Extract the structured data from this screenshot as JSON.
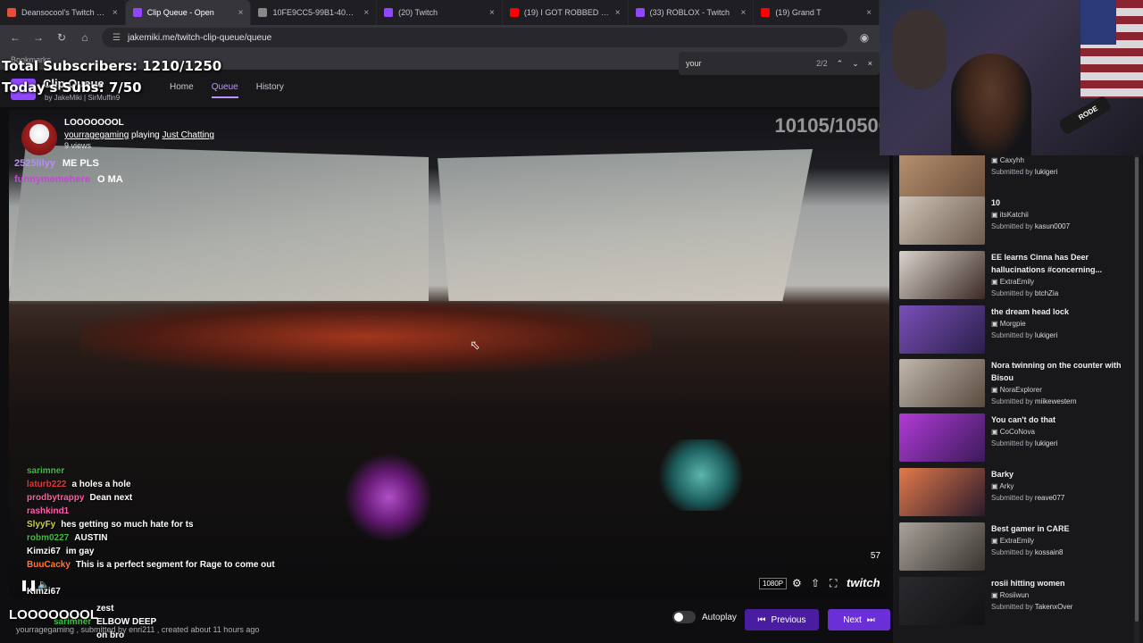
{
  "browser": {
    "tabs": [
      {
        "title": "Deansocool's Twitch Statistic",
        "color": "#e74c3c",
        "active": false
      },
      {
        "title": "Clip Queue - Open",
        "color": "#9147ff",
        "active": true
      },
      {
        "title": "10FE9CC5-99B1-40FD-A523",
        "color": "#888888",
        "active": false
      },
      {
        "title": "(20) Twitch",
        "color": "#9147ff",
        "active": false
      },
      {
        "title": "(19) I GOT ROBBED - The Lon",
        "color": "#ff0000",
        "active": false
      },
      {
        "title": "(33) ROBLOX - Twitch",
        "color": "#9147ff",
        "active": false
      },
      {
        "title": "(19) Grand T",
        "color": "#ff0000",
        "active": false
      }
    ],
    "url": "jakemiki.me/twitch-clip-queue/queue",
    "bookmarks": "Bookmarks",
    "find": {
      "query": "your",
      "count": "2/2"
    }
  },
  "overlay": {
    "total_subs": "Total Subscribers: 1210/1250",
    "today_subs": "Today's Subs: 7/50",
    "viewers": "10105/10500"
  },
  "app": {
    "name": "Clip Queue",
    "by": "by JakeMiki | SirMuffin9",
    "nav": [
      {
        "label": "Home",
        "selected": false
      },
      {
        "label": "Queue",
        "selected": true
      },
      {
        "label": "History",
        "selected": false
      }
    ]
  },
  "clip": {
    "title": "LOOOOOOOL",
    "channel": "yourragegaming",
    "playing": "playing",
    "category": "Just Chatting",
    "views": "9 views"
  },
  "overlay_chat": [
    {
      "name": "2525lilyy",
      "msg": "ME PLS",
      "color": "#b98cf5"
    },
    {
      "name": "funnymemehere",
      "msg": "O MA",
      "color": "#c14ad0"
    }
  ],
  "chat": [
    {
      "name": "sarimner",
      "msg": "",
      "color": "#3fbf3f"
    },
    {
      "name": "laturb222",
      "msg": "a holes a hole",
      "color": "#d93b3b"
    },
    {
      "name": "prodbytrappy",
      "msg": "Dean next",
      "color": "#ff5fa0"
    },
    {
      "name": "rashkind1",
      "msg": "",
      "color": "#ff5fb0"
    },
    {
      "name": "SlyyFy",
      "msg": "hes getting so much hate for ts",
      "color": "#cfcf3a"
    },
    {
      "name": "robm0227",
      "msg": "AUSTIN",
      "color": "#3fbf3f"
    },
    {
      "name": "Kimzi67",
      "msg": "im gay",
      "color": "#ffffff"
    },
    {
      "name": "BuuCacky",
      "msg": "This is a perfect segment for Rage to come out",
      "color": "#ff7a3a"
    },
    {
      "name": "Kimzi67",
      "msg": "",
      "color": "#ffffff"
    }
  ],
  "player": {
    "counter": "57",
    "quality": "1080P",
    "brand": "twitch"
  },
  "footer": {
    "clip_name": "LOOOOOOOL",
    "meta": "yourragegaming , submitted by enri211 , created about 11 hours ago",
    "chat": [
      {
        "name": "",
        "msg": "zest"
      },
      {
        "name": "sarimner",
        "msg": "ELBOW DEEP"
      },
      {
        "name": "",
        "msg": "on bro"
      }
    ],
    "autoplay": "Autoplay",
    "previous": "Previous",
    "next": "Next"
  },
  "webcam": {
    "mic_label": "RODE"
  },
  "queue": [
    {
      "title": "",
      "channel": "Caxyhh",
      "submitter": "lukigeri",
      "thumb": [
        "#b89270",
        "#6a4e3a"
      ]
    },
    {
      "title": "10",
      "channel": "itsKatchii",
      "submitter": "kasun0007",
      "thumb": [
        "#cfc4b8",
        "#6b5a4d"
      ]
    },
    {
      "title": "EE learns Cinna has Deer hallucinations #concerning...",
      "channel": "ExtraEmily",
      "submitter": "btchZia",
      "thumb": [
        "#d9d2cc",
        "#3b2a25"
      ]
    },
    {
      "title": "the dream head lock",
      "channel": "Morgpie",
      "submitter": "lukigeri",
      "thumb": [
        "#7a4fb8",
        "#2a1f4a"
      ]
    },
    {
      "title": "Nora twinning on the counter with Bisou",
      "channel": "NoraExplorer",
      "submitter": "miikewestern",
      "thumb": [
        "#bfb7ad",
        "#5a4a3e"
      ]
    },
    {
      "title": "You can't do that",
      "channel": "CoCoNova",
      "submitter": "lukigeri",
      "thumb": [
        "#b23ad6",
        "#3a1a5a"
      ]
    },
    {
      "title": "Barky",
      "channel": "Arky",
      "submitter": "reave077",
      "thumb": [
        "#e37a4a",
        "#2a1a2a"
      ]
    },
    {
      "title": "Best gamer in CARE",
      "channel": "ExtraEmily",
      "submitter": "kossain8",
      "thumb": [
        "#a8a29a",
        "#3a3430"
      ]
    },
    {
      "title": "rosii hitting women",
      "channel": "Rosiiwun",
      "submitter": "TakenxOver",
      "thumb": [
        "#2a2a2e",
        "#111114"
      ]
    }
  ]
}
